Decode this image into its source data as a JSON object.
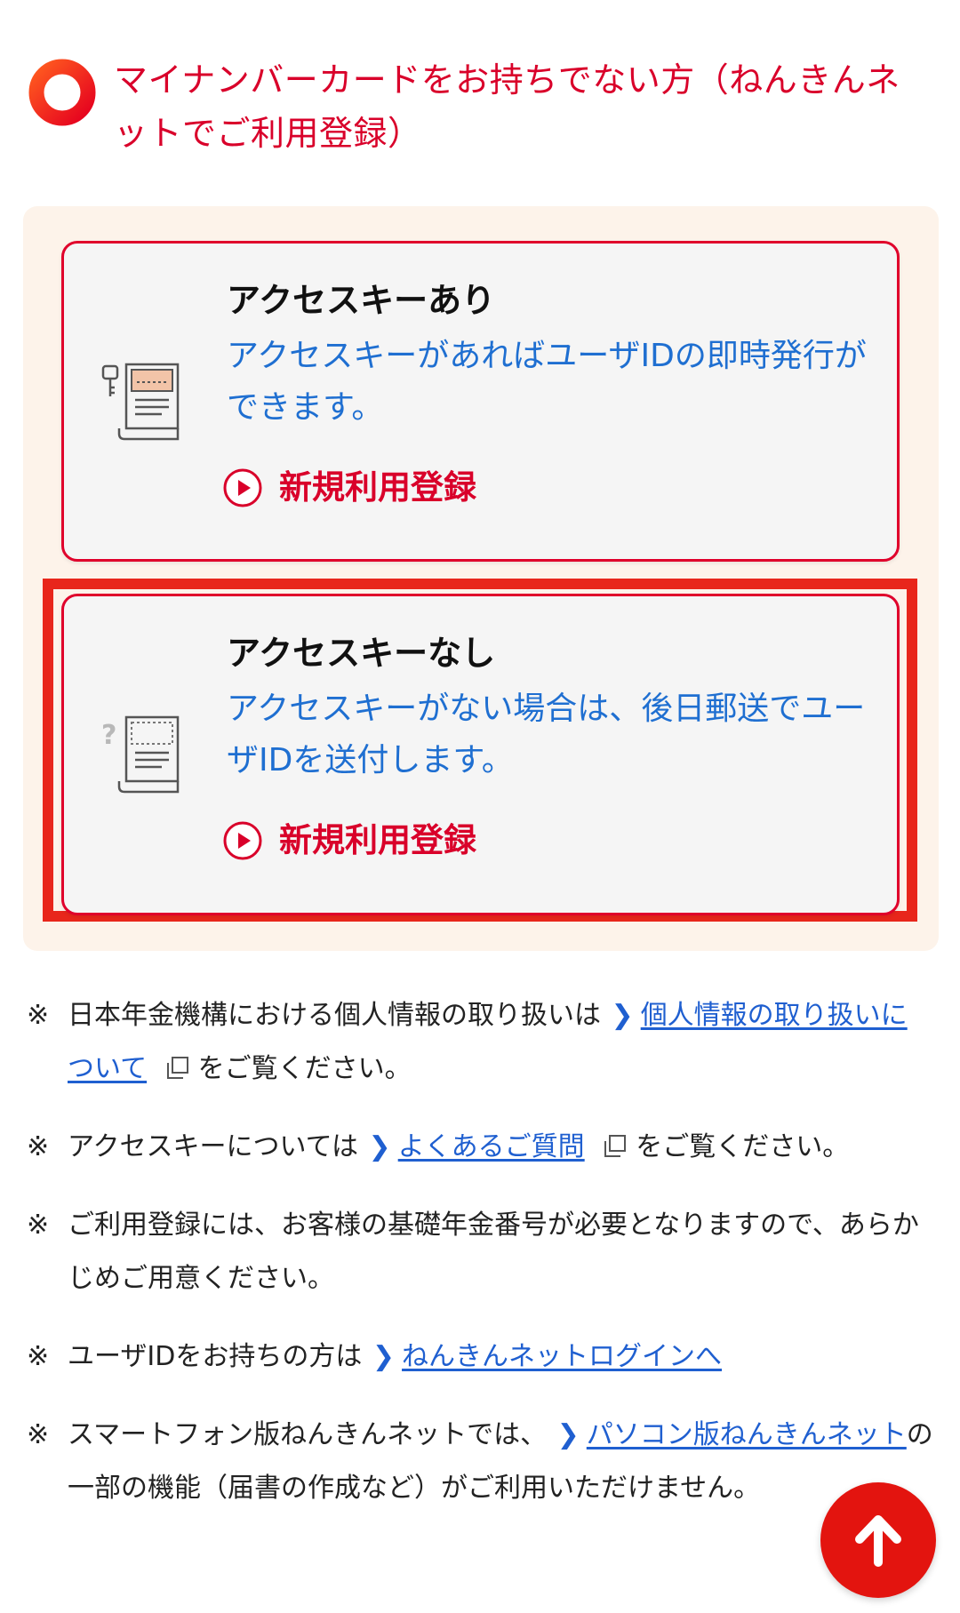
{
  "section": {
    "title": "マイナンバーカードをお持ちでない方（ねんきんネットでご利用登録）"
  },
  "cards": [
    {
      "title": "アクセスキーあり",
      "description": "アクセスキーがあればユーザIDの即時発行ができます。",
      "link_label": "新規利用登録",
      "icon": "key-document-icon"
    },
    {
      "title": "アクセスキーなし",
      "description": "アクセスキーがない場合は、後日郵送でユーザIDを送付します。",
      "link_label": "新規利用登録",
      "icon": "question-document-icon"
    }
  ],
  "notes": {
    "mark": "※",
    "privacy": {
      "before": "日本年金機構における個人情報の取り扱いは",
      "link": "個人情報の取り扱いについて",
      "after": "をご覧ください。"
    },
    "faq": {
      "before": "アクセスキーについては",
      "link": "よくあるご質問",
      "after": "をご覧ください。"
    },
    "basic_number": {
      "text": "ご利用登録には、お客様の基礎年金番号が必要となりますので、あらかじめご用意ください。"
    },
    "login": {
      "before": "ユーザIDをお持ちの方は",
      "link": "ねんきんネットログインへ"
    },
    "pc_version": {
      "before": "スマートフォン版ねんきんネットでは、",
      "link": "パソコン版ねんきんネット",
      "after": "の一部の機能（届書の作成など）がご利用いただけません。"
    }
  },
  "colors": {
    "brand_red": "#d9002a",
    "link_blue": "#1f5fd0",
    "panel_bg": "#fdf3ea",
    "highlight": "#e8261b"
  },
  "icons": {
    "section": "ring-icon",
    "link": "chevron-right-icon",
    "external": "external-link-icon",
    "play": "play-circle-icon",
    "back_to_top": "arrow-up-icon"
  }
}
